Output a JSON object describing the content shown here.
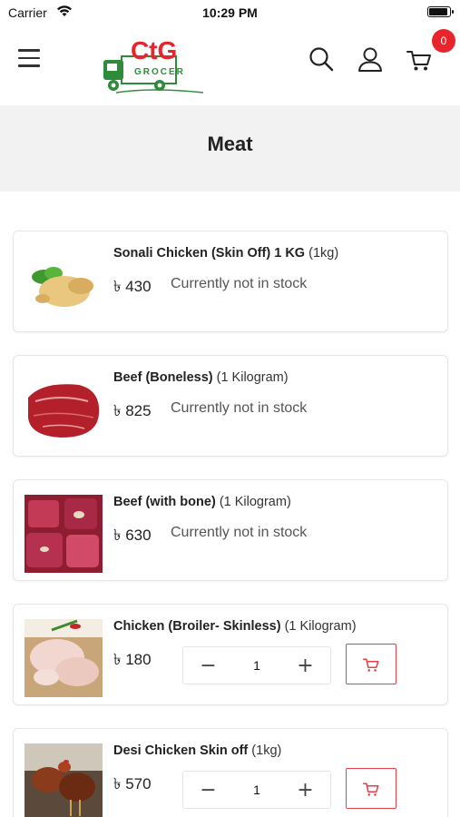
{
  "status_bar": {
    "carrier": "Carrier",
    "time": "10:29 PM",
    "battery_level": 0.9
  },
  "header": {
    "logo_text": "CtG",
    "logo_subtext": "GROCER",
    "cart_count": "0",
    "icons": [
      "menu-icon",
      "logo",
      "search-icon",
      "user-icon",
      "cart-icon"
    ]
  },
  "page": {
    "title": "Meat"
  },
  "products": [
    {
      "name": "Sonali Chicken (Skin Off) 1 KG",
      "unit": "(1kg)",
      "price": "৳ 430",
      "status": "Currently not in stock",
      "image": "chicken-whole"
    },
    {
      "name": "Beef (Boneless)",
      "unit": "(1 Kilogram)",
      "price": "৳ 825",
      "status": "Currently not in stock",
      "image": "beef-boneless"
    },
    {
      "name": "Beef (with bone)",
      "unit": "(1 Kilogram)",
      "price": "৳ 630",
      "status": "Currently not in stock",
      "image": "beef-bone"
    },
    {
      "name": "Chicken (Broiler- Skinless)",
      "unit": "(1 Kilogram)",
      "price": "৳ 180",
      "quantity": "1",
      "minus": "−",
      "plus": "+",
      "image": "chicken-broiler"
    },
    {
      "name": "Desi Chicken Skin off",
      "unit": "(1kg)",
      "price": "৳ 570",
      "quantity": "1",
      "minus": "−",
      "plus": "+",
      "image": "desi-chicken"
    }
  ],
  "colors": {
    "accent": "#e8242c",
    "brand_green": "#2e8b3a",
    "title_band": "#f2f2f2"
  }
}
